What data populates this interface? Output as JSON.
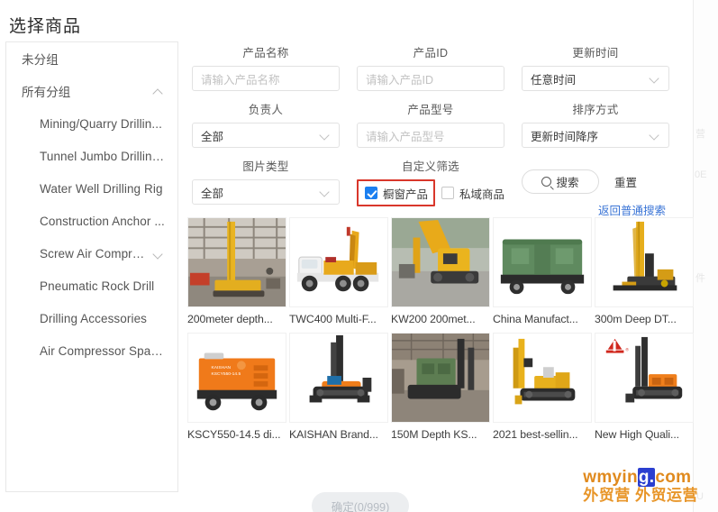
{
  "page": {
    "title": "选择商品"
  },
  "sidebar": {
    "items": [
      {
        "label": "未分组",
        "level": 0,
        "chevron": "none"
      },
      {
        "label": "所有分组",
        "level": 0,
        "chevron": "up"
      },
      {
        "label": "Mining/Quarry Drillin...",
        "level": 1,
        "chevron": "none"
      },
      {
        "label": "Tunnel Jumbo Drilling...",
        "level": 1,
        "chevron": "none"
      },
      {
        "label": "Water Well Drilling Rig",
        "level": 1,
        "chevron": "none"
      },
      {
        "label": "Construction Anchor ...",
        "level": 1,
        "chevron": "none"
      },
      {
        "label": "Screw Air Compressor",
        "level": 1,
        "chevron": "down"
      },
      {
        "label": "Pneumatic Rock Drill",
        "level": 1,
        "chevron": "none"
      },
      {
        "label": "Drilling Accessories",
        "level": 1,
        "chevron": "none"
      },
      {
        "label": "Air Compressor Spare...",
        "level": 1,
        "chevron": "none"
      }
    ]
  },
  "filters": {
    "product_name": {
      "label": "产品名称",
      "placeholder": "请输入产品名称",
      "value": ""
    },
    "product_id": {
      "label": "产品ID",
      "placeholder": "请输入产品ID",
      "value": ""
    },
    "update_time": {
      "label": "更新时间",
      "value": "任意时间"
    },
    "owner": {
      "label": "负责人",
      "value": "全部"
    },
    "product_model": {
      "label": "产品型号",
      "placeholder": "请输入产品型号",
      "value": ""
    },
    "sort_order": {
      "label": "排序方式",
      "value": "更新时间降序"
    },
    "image_type": {
      "label": "图片类型",
      "value": "全部"
    },
    "custom_filter": {
      "label": "自定义筛选",
      "showcase": {
        "label": "橱窗产品",
        "checked": true,
        "highlighted": true
      },
      "private": {
        "label": "私域商品",
        "checked": false,
        "highlighted": false
      }
    },
    "highlight_color": "#d9372b"
  },
  "actions": {
    "search_label": "搜索",
    "reset_label": "重置",
    "back_link_label": "返回普通搜索",
    "link_color": "#3a74d6"
  },
  "products": [
    {
      "caption": "200meter depth...",
      "art": "rig-indoor"
    },
    {
      "caption": "TWC400 Multi-F...",
      "art": "truck-rig"
    },
    {
      "caption": "KW200 200met...",
      "art": "crawler-yellow"
    },
    {
      "caption": "China Manufact...",
      "art": "green-compressor"
    },
    {
      "caption": "300m Deep DT...",
      "art": "rig-white-bg"
    },
    {
      "caption": "KSCY550-14.5 di...",
      "art": "orange-compressor"
    },
    {
      "caption": "KAISHAN Brand...",
      "art": "black-crawler-rig"
    },
    {
      "caption": "150M Depth KS...",
      "art": "green-crawler"
    },
    {
      "caption": "2021 best-sellin...",
      "art": "yellow-drill-crawler"
    },
    {
      "caption": "New High Quali...",
      "art": "orange-drill-logo"
    }
  ],
  "footer": {
    "confirm_label": "确定(0/999)"
  },
  "watermark": {
    "line1_a": "wmyin",
    "line1_blue": "g.",
    "line1_b": "com",
    "line2": "外贸营 外贸运营",
    "color": "#e08a1e",
    "accent": "#2b3fd0"
  }
}
